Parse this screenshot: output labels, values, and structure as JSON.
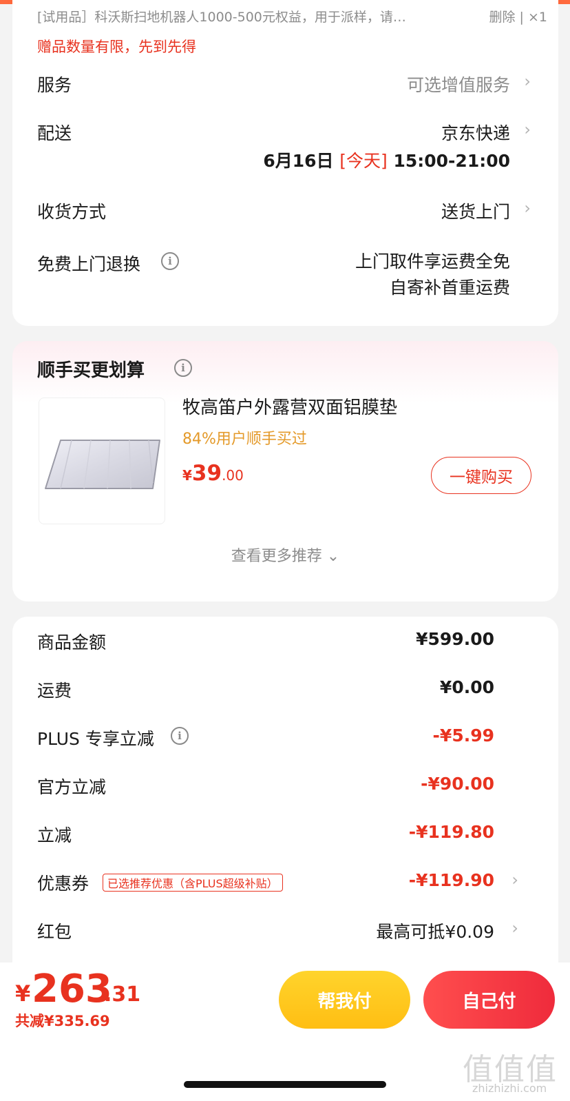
{
  "gift": {
    "description": "[试用品］科沃斯扫地机器人1000-500元权益，用于派样，请…",
    "delete": "删除 | ×1",
    "notice": "赠品数量有限，先到先得"
  },
  "service": {
    "label": "服务",
    "value": "可选增值服务"
  },
  "delivery": {
    "label": "配送",
    "carrier": "京东快递",
    "date": "6月16日",
    "today": "[今天]",
    "time": "15:00-21:00"
  },
  "receive": {
    "label": "收货方式",
    "value": "送货上门"
  },
  "returns": {
    "label": "免费上门退换",
    "line1": "上门取件享运费全免",
    "line2": "自寄补首重运费"
  },
  "addon": {
    "title": "顺手买更划算",
    "product_name": "牧高笛户外露营双面铝膜垫",
    "buyers": "84%用户顺手买过",
    "price_symbol": "¥",
    "price_int": "39",
    "price_dec": ".00",
    "buy_button": "一键购买",
    "more": "查看更多推荐 ⌄"
  },
  "summary": {
    "goods_label": "商品金额",
    "goods_value": "¥599.00",
    "shipping_label": "运费",
    "shipping_value": "¥0.00",
    "plus_label": "PLUS 专享立减",
    "plus_value": "-¥5.99",
    "official_label": "官方立减",
    "official_value": "-¥90.00",
    "instant_label": "立减",
    "instant_value": "-¥119.80",
    "coupon_label": "优惠券",
    "coupon_tag": "已选推荐优惠（含PLUS超级补贴）",
    "coupon_value": "-¥119.90",
    "redpack_label": "红包",
    "redpack_value": "最高可抵¥0.09"
  },
  "bottom": {
    "symbol": "¥",
    "total_int": "263",
    "total_dec": ".31",
    "saved": "共减¥335.69",
    "help_pay": "帮我付",
    "self_pay": "自己付"
  },
  "watermark": {
    "mark": "值值值",
    "site": "zhizhizhi.com"
  },
  "colors": {
    "accent": "#e8321f",
    "help_button": "#ffc61f",
    "pay_button": "#f23340",
    "addon_highlight": "#e49a2a"
  },
  "icons": {
    "info": "info-circle-icon",
    "chevron": "chevron-right-icon",
    "product_image": "picnic-mat-image"
  }
}
